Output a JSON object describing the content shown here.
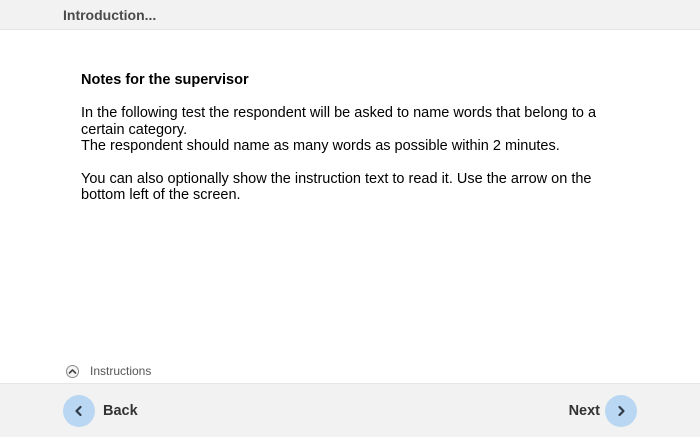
{
  "header": {
    "title": "Introduction..."
  },
  "content": {
    "heading": "Notes for the supervisor",
    "paragraph1": {
      "line1": "In the following test the respondent will be asked to name words that belong to a",
      "line2": "certain category.",
      "line3": "The respondent should name as many words as possible within 2 minutes."
    },
    "paragraph2": {
      "line1": "You can also optionally show the instruction text to read it. Use the arrow on the",
      "line2": "bottom left of the screen."
    }
  },
  "instructions": {
    "label": "Instructions",
    "icon": "chevron-up-icon"
  },
  "footer": {
    "back_label": "Back",
    "next_label": "Next",
    "button_color": "#b9d6f2",
    "icons": {
      "back": "chevron-left-icon",
      "next": "chevron-right-icon"
    }
  }
}
